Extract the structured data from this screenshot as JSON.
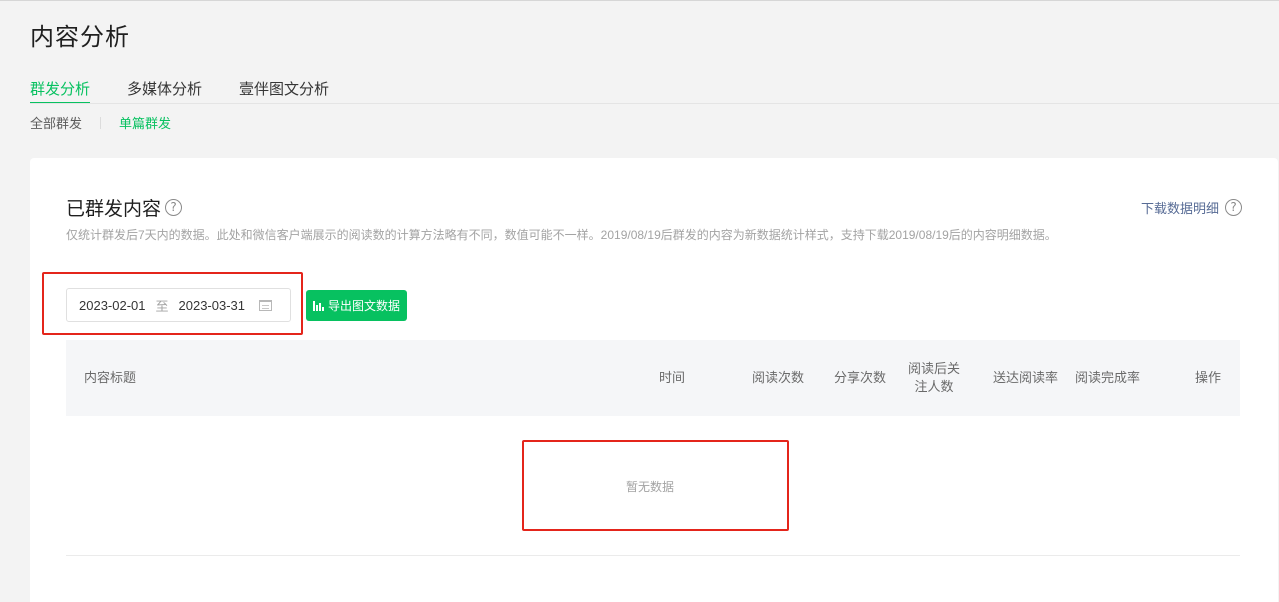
{
  "page": {
    "title": "内容分析"
  },
  "tabs": [
    {
      "label": "群发分析",
      "active": true
    },
    {
      "label": "多媒体分析",
      "active": false
    },
    {
      "label": "壹伴图文分析",
      "active": false
    }
  ],
  "subtabs": [
    {
      "label": "全部群发",
      "active": false
    },
    {
      "label": "单篇群发",
      "active": true
    }
  ],
  "section": {
    "title": "已群发内容",
    "help_icon": "question-circle-icon",
    "download_label": "下载数据明细",
    "note": "仅统计群发后7天内的数据。此处和微信客户端展示的阅读数的计算方法略有不同，数值可能不一样。2019/08/19后群发的内容为新数据统计样式，支持下载2019/08/19后的内容明细数据。"
  },
  "filter": {
    "start_date": "2023-02-01",
    "separator": "至",
    "end_date": "2023-03-31",
    "calendar_icon": "calendar-icon",
    "export_label": "导出图文数据",
    "export_icon": "bar-chart-icon"
  },
  "table": {
    "columns": [
      {
        "label": "内容标题"
      },
      {
        "label": "时间"
      },
      {
        "label": "阅读次数"
      },
      {
        "label": "分享次数"
      },
      {
        "label": "阅读后关注人数"
      },
      {
        "label": "送达阅读率"
      },
      {
        "label": "阅读完成率"
      },
      {
        "label": "操作"
      }
    ],
    "empty_text": "暂无数据"
  },
  "colors": {
    "accent": "#07c160",
    "link": "#576b95",
    "highlight": "#e4251b"
  }
}
